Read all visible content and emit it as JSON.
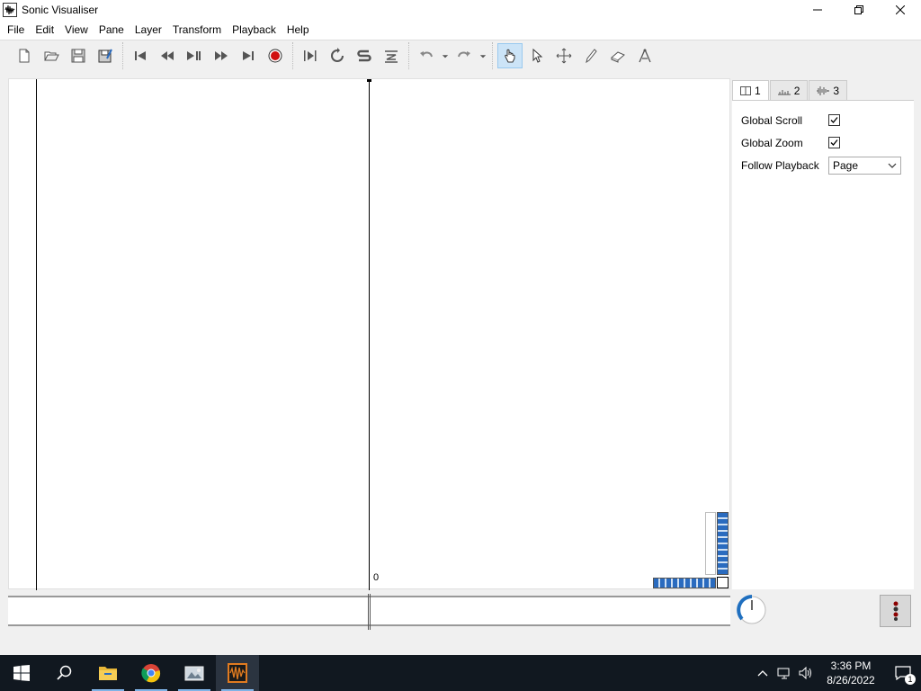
{
  "window": {
    "title": "Sonic Visualiser"
  },
  "menu": [
    "File",
    "Edit",
    "View",
    "Pane",
    "Layer",
    "Transform",
    "Playback",
    "Help"
  ],
  "toolbar": {
    "file": [
      "new-icon",
      "open-icon",
      "save-icon",
      "save-as-icon"
    ],
    "transport": [
      "rewind-start-icon",
      "rewind-icon",
      "play-pause-icon",
      "fast-forward-icon",
      "fast-forward-end-icon",
      "record-icon"
    ],
    "playback_mode": [
      "play-selection-icon",
      "loop-icon",
      "solo-icon",
      "align-icon"
    ],
    "edit": [
      "undo-icon",
      "redo-icon"
    ],
    "tools": [
      "navigate-tool-icon",
      "select-tool-icon",
      "move-tool-icon",
      "draw-tool-icon",
      "erase-tool-icon",
      "measure-tool-icon"
    ],
    "active_tool": "navigate-tool-icon"
  },
  "pane": {
    "center_label": "0"
  },
  "side_panel": {
    "tabs": [
      {
        "label": "1",
        "icon": "pane-icon",
        "active": true
      },
      {
        "label": "2",
        "icon": "ruler-icon",
        "active": false
      },
      {
        "label": "3",
        "icon": "waveform-icon",
        "active": false
      }
    ],
    "global_scroll": {
      "label": "Global Scroll",
      "checked": true
    },
    "global_zoom": {
      "label": "Global Zoom",
      "checked": true
    },
    "follow_playback": {
      "label": "Follow Playback",
      "value": "Page"
    }
  },
  "taskbar": {
    "apps": [
      "start-icon",
      "search-icon",
      "file-explorer-icon",
      "chrome-icon",
      "photos-icon",
      "sonic-visualiser-icon"
    ],
    "time": "3:36 PM",
    "date": "8/26/2022",
    "notification_count": "1"
  }
}
